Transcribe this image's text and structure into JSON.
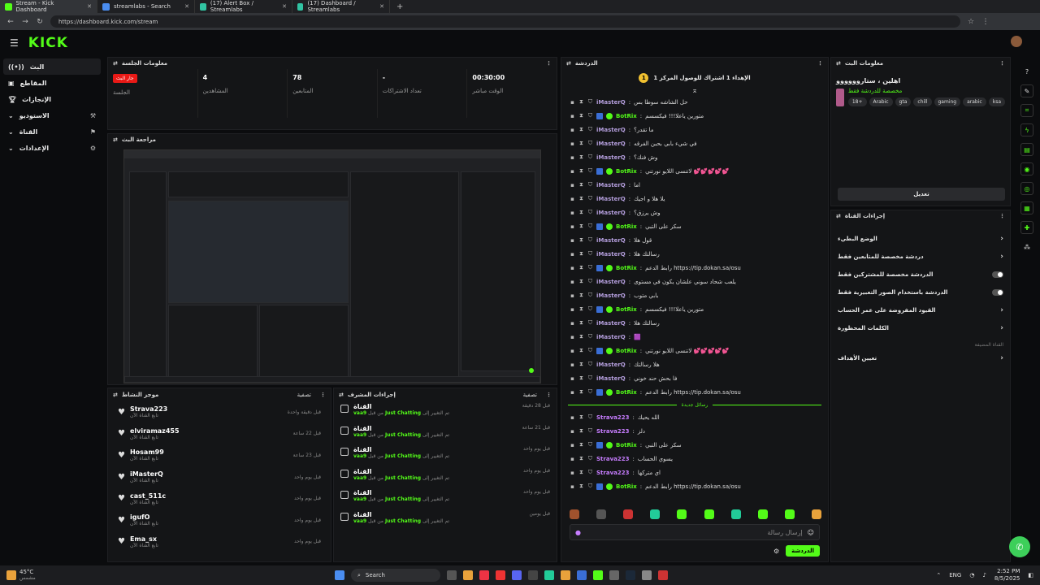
{
  "browser": {
    "tabs": [
      {
        "title": "Stream - Kick Dashboard",
        "color": "#53fc18"
      },
      {
        "title": "streamlabs - Search",
        "color": "#4a8df0"
      },
      {
        "title": "(17) Alert Box / Streamlabs",
        "color": "#31c3a2"
      },
      {
        "title": "(17) Dashboard / Streamlabs",
        "color": "#31c3a2"
      }
    ],
    "url": "https://dashboard.kick.com/stream"
  },
  "brand": {
    "logo": "KICK",
    "accent": "#53fc18"
  },
  "sidebar": {
    "items": [
      {
        "label": "البث",
        "icon": "live-icon"
      },
      {
        "label": "المقاطع",
        "icon": "clips-icon"
      },
      {
        "label": "الإنجازات",
        "icon": "trophy-icon"
      },
      {
        "label": "الاستوديو",
        "icon": "studio-icon"
      },
      {
        "label": "القناة",
        "icon": "channel-icon"
      },
      {
        "label": "الإعدادات",
        "icon": "settings-icon"
      }
    ]
  },
  "session": {
    "title": "معلومات الجلسة",
    "live_badge": "جار البث",
    "session_label": "الجلسة",
    "viewers_value": "4",
    "viewers_label": "المشاهدين",
    "followers_value": "78",
    "followers_label": "المتابعين",
    "subs_value": "-",
    "subs_label": "تعداد الاشتراكات",
    "time_value": "00:30:00",
    "time_label": "الوقت مباشر"
  },
  "preview": {
    "title": "مراجعة البث"
  },
  "activity": {
    "title": "موجز النشاط",
    "filter": "تصفية",
    "subtitle": "تابع القناة الآن",
    "items": [
      {
        "name": "Strava223",
        "time": "قبل دقيقة واحدة"
      },
      {
        "name": "elviramaz455",
        "time": "قبل 22 ساعة"
      },
      {
        "name": "Hosam99",
        "time": "قبل 23 ساعة"
      },
      {
        "name": "iMasterQ",
        "time": "قبل يوم واحد"
      },
      {
        "name": "cast_511c",
        "time": "قبل يوم واحد"
      },
      {
        "name": "igufO",
        "time": "قبل يوم واحد"
      },
      {
        "name": "Ema_sx",
        "time": "قبل يوم واحد"
      }
    ]
  },
  "modactions": {
    "title": "إجراءات المشرف",
    "filter": "تصفية",
    "items": [
      {
        "head": "القناة",
        "user": "vaa9",
        "game": "Just Chatting",
        "time": "قبل 28 دقيقة"
      },
      {
        "head": "القناة",
        "user": "vaa9",
        "game": "Just Chatting",
        "time": "قبل 21 ساعة"
      },
      {
        "head": "القناة",
        "user": "vaa9",
        "game": "Just Chatting",
        "time": "قبل يوم واحد"
      },
      {
        "head": "القناة",
        "user": "vaa9",
        "game": "Just Chatting",
        "time": "قبل يوم واحد"
      },
      {
        "head": "القناة",
        "user": "vaa9",
        "game": "Just Chatting",
        "time": "قبل يوم واحد"
      },
      {
        "head": "القناة",
        "user": "vaa9",
        "game": "Just Chatting",
        "time": "قبل يومين"
      }
    ],
    "text_from": "من قبل",
    "text_changed": "تم التغيير إلى"
  },
  "chat": {
    "title": "الدردشة",
    "pinned": "الإهداء 1 اشتراك للوصول المركز 1",
    "new_messages": "رسائل جديدة",
    "input_placeholder": "إرسال رسالة",
    "send_label": "الدردشة",
    "messages": [
      {
        "user": "iMasterQ",
        "color": "#b39ddb",
        "text": "حل الشاشه سوطا بس",
        "bot": false
      },
      {
        "user": "BotRix",
        "color": "#53fc18",
        "text": "متورين ياعلا!!! فيكسسم",
        "bot": true
      },
      {
        "user": "iMasterQ",
        "color": "#b39ddb",
        "text": "ما تقدر؟",
        "bot": false
      },
      {
        "user": "iMasterQ",
        "color": "#b39ddb",
        "text": "في شيء بابي بحبن الفرقه",
        "bot": false
      },
      {
        "user": "iMasterQ",
        "color": "#b39ddb",
        "text": "وش فنك؟",
        "bot": false
      },
      {
        "user": "BotRix",
        "color": "#53fc18",
        "text": "لاتنسى اللايو نورتني 💕💕💕💕💕",
        "bot": true
      },
      {
        "user": "iMasterQ",
        "color": "#b39ddb",
        "text": "اما",
        "bot": false
      },
      {
        "user": "iMasterQ",
        "color": "#b39ddb",
        "text": "يلا هلا و اجيك",
        "bot": false
      },
      {
        "user": "iMasterQ",
        "color": "#b39ddb",
        "text": "وش يرزق؟",
        "bot": false
      },
      {
        "user": "BotRix",
        "color": "#53fc18",
        "text": "سكر على التبي",
        "bot": true
      },
      {
        "user": "iMasterQ",
        "color": "#b39ddb",
        "text": "قول هلا",
        "bot": false
      },
      {
        "user": "iMasterQ",
        "color": "#b39ddb",
        "text": "رسالتك هلا",
        "bot": false
      },
      {
        "user": "BotRix",
        "color": "#53fc18",
        "text": "رابط الدعم https://tip.dokan.sa/osu",
        "bot": true
      },
      {
        "user": "iMasterQ",
        "color": "#b39ddb",
        "text": "يلعب شحاد سوني علشان يكون في مستوى",
        "bot": false
      },
      {
        "user": "iMasterQ",
        "color": "#b39ddb",
        "text": "بابي متوب",
        "bot": false
      },
      {
        "user": "BotRix",
        "color": "#53fc18",
        "text": "متورين ياعلا!!! فيكسسم",
        "bot": true
      },
      {
        "user": "iMasterQ",
        "color": "#b39ddb",
        "text": "رسالتك هلا",
        "bot": false
      },
      {
        "user": "iMasterQ",
        "color": "#b39ddb",
        "text": "🟪",
        "bot": false
      },
      {
        "user": "BotRix",
        "color": "#53fc18",
        "text": "لاتنسى اللايو نورتني 💕💕💕💕💕",
        "bot": true
      },
      {
        "user": "iMasterQ",
        "color": "#b39ddb",
        "text": "هلا رسالتك",
        "bot": false
      },
      {
        "user": "iMasterQ",
        "color": "#b39ddb",
        "text": "فا بحش حند خوني",
        "bot": false
      },
      {
        "user": "BotRix",
        "color": "#53fc18",
        "text": "رابط الدعم https://tip.dokan.sa/osu",
        "bot": true
      }
    ],
    "new": [
      {
        "user": "Strava223",
        "color": "#c77dff",
        "text": "الله يحيك",
        "bot": false
      },
      {
        "user": "Strava223",
        "color": "#c77dff",
        "text": "دلز",
        "bot": false
      },
      {
        "user": "BotRix",
        "color": "#53fc18",
        "text": "سكر على التبي",
        "bot": true
      },
      {
        "user": "Strava223",
        "color": "#c77dff",
        "text": "يسوي الحساب",
        "bot": false
      },
      {
        "user": "Strava223",
        "color": "#c77dff",
        "text": "اي متركها",
        "bot": false
      },
      {
        "user": "BotRix",
        "color": "#53fc18",
        "text": "رابط الدعم https://tip.dokan.sa/osu",
        "bot": true
      }
    ]
  },
  "streaminfo": {
    "title": "معلومات البث",
    "stream_title": "اهلين ، ستاروووووو",
    "category": "مخصصة للدردشة فقط",
    "tags": [
      "18+",
      "Arabic",
      "gta",
      "chill",
      "gaming",
      "arabic",
      "ksa"
    ],
    "edit_label": "تعديل"
  },
  "channelactions": {
    "title": "إجراءات القناة",
    "items": [
      {
        "label": "الوضع البطيء",
        "type": "chevron"
      },
      {
        "label": "دردشة مخصصة للمتابعين فقط",
        "type": "chevron"
      },
      {
        "label": "الدردشة مخصصة للمشتركين فقط",
        "type": "toggle"
      },
      {
        "label": "الدردشة باستخدام الصور التعبيرية فقط",
        "type": "toggle"
      },
      {
        "label": "القيود المفروضة على عمر الحساب",
        "type": "chevron"
      },
      {
        "label": "الكلمات المحظورة",
        "type": "chevron"
      }
    ],
    "section": "القناة المضيفة",
    "goal": "تعيين الأهداف"
  },
  "taskbar": {
    "weather": "45°C",
    "weather_sub": "مشمس",
    "search": "Search",
    "lang": "ENG",
    "time": "2:52 PM",
    "date": "8/5/2025"
  }
}
